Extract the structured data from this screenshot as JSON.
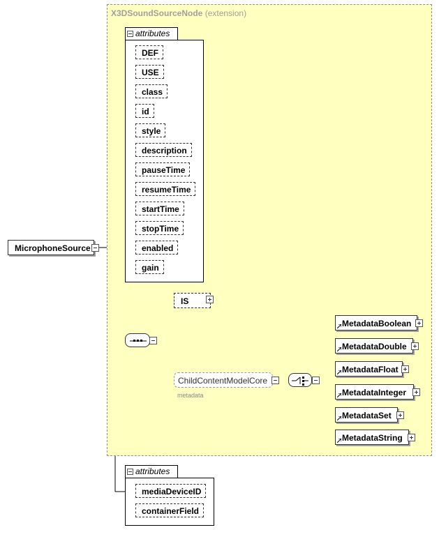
{
  "extension": {
    "title": "X3DSoundSourceNode",
    "suffix": "(extension)"
  },
  "root": {
    "label": "MicrophoneSource"
  },
  "attributes_group": {
    "tab_label": "attributes",
    "items": [
      "DEF",
      "USE",
      "class",
      "id",
      "style",
      "description",
      "pauseTime",
      "resumeTime",
      "startTime",
      "stopTime",
      "enabled",
      "gain"
    ]
  },
  "sequence": {
    "is_element": "IS",
    "child_group": {
      "label": "ChildContentModelCore",
      "sublabel": "metadata"
    },
    "choices": [
      "MetadataBoolean",
      "MetadataDouble",
      "MetadataFloat",
      "MetadataInteger",
      "MetadataSet",
      "MetadataString"
    ]
  },
  "own_attributes": {
    "tab_label": "attributes",
    "items": [
      "mediaDeviceID",
      "containerField"
    ]
  }
}
